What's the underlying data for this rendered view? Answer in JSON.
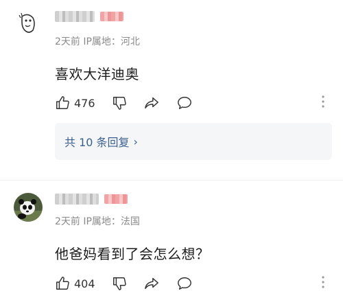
{
  "comments": [
    {
      "meta": "2天前 IP属地：河北",
      "text": "喜欢大洋迪奥",
      "likes": "476",
      "replies_label": "共 10 条回复",
      "replies_chevron": "›"
    },
    {
      "meta": "2天前 IP属地：法国",
      "text": "他爸妈看到了会怎么想？",
      "likes": "404"
    }
  ]
}
